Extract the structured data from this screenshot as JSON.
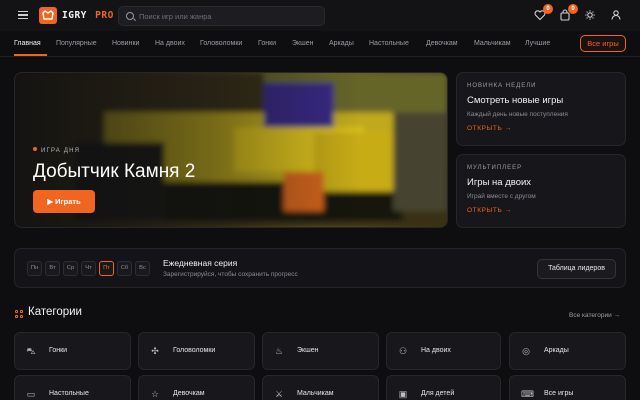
{
  "header": {
    "logo_text": "IGRY",
    "logo_pro": "PRO",
    "search_placeholder": "Поиск игр или жанра",
    "badge_favorites": "0",
    "badge_cart": "0"
  },
  "nav": {
    "items": [
      "Главная",
      "Популярные",
      "Новинки",
      "На двоих",
      "Головоломки",
      "Гонки",
      "Экшен",
      "Аркады",
      "Настольные",
      "Девочкам",
      "Мальчикам",
      "Лучшие"
    ],
    "all_games": "Все игры"
  },
  "hero": {
    "kicker": "ИГРА ДНЯ",
    "title": "Добытчик Камня 2",
    "play_label": "▶  Играть"
  },
  "side_cards": [
    {
      "kicker": "НОВИНКА НЕДЕЛИ",
      "title": "Смотреть новые игры",
      "sub": "Каждый день новые поступления",
      "link": "ОТКРЫТЬ →"
    },
    {
      "kicker": "МУЛЬТИПЛЕЕР",
      "title": "Игры на двоих",
      "sub": "Играй вместе с другом",
      "link": "ОТКРЫТЬ →"
    }
  ],
  "streak": {
    "days": [
      "Пн",
      "Вт",
      "Ср",
      "Чт",
      "Пт",
      "Сб",
      "Вс"
    ],
    "active_day": "Пт",
    "title": "Ежедневная серия",
    "sub": "Зарегистрируйся, чтобы сохранить прогресс",
    "leaders_label": "Таблица лидеров"
  },
  "categories": {
    "title": "Категории",
    "all_label": "Все категории →",
    "items": [
      {
        "label": "Гонки",
        "icon": "car-icon"
      },
      {
        "label": "Головоломки",
        "icon": "puzzle-icon"
      },
      {
        "label": "Экшен",
        "icon": "fire-icon"
      },
      {
        "label": "На двоих",
        "icon": "users-icon"
      },
      {
        "label": "Аркады",
        "icon": "target-icon"
      },
      {
        "label": "Настольные",
        "icon": "board-icon"
      },
      {
        "label": "Девочкам",
        "icon": "star-icon"
      },
      {
        "label": "Мальчикам",
        "icon": "sword-icon"
      },
      {
        "label": "Для детей",
        "icon": "gamepad-icon"
      },
      {
        "label": "Все игры",
        "icon": "controller-icon"
      }
    ]
  }
}
